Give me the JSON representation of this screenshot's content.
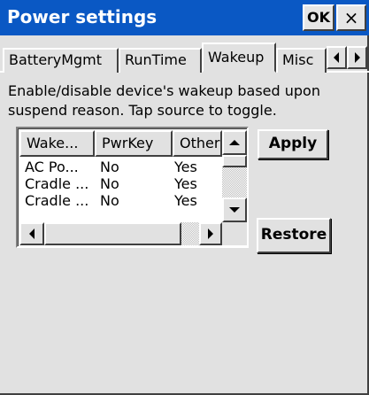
{
  "window": {
    "title": "Power settings",
    "ok_label": "OK",
    "close_label": "×"
  },
  "tabs": [
    {
      "label": "BatteryMgmt",
      "active": false
    },
    {
      "label": "RunTime",
      "active": false
    },
    {
      "label": "Wakeup",
      "active": true
    },
    {
      "label": "Misc",
      "active": false
    }
  ],
  "tab_scroll": {
    "left_icon": "triangle-left-icon",
    "right_icon": "triangle-right-icon"
  },
  "description": "Enable/disable device's wakeup based upon suspend reason. Tap source to toggle.",
  "list": {
    "columns": [
      "Wake...",
      "PwrKey",
      "Other"
    ],
    "rows": [
      [
        "AC Po...",
        "No",
        "Yes"
      ],
      [
        "Cradle ...",
        "No",
        "Yes"
      ],
      [
        "Cradle ...",
        "No",
        "Yes"
      ]
    ]
  },
  "buttons": {
    "apply": "Apply",
    "restore": "Restore"
  },
  "colors": {
    "titlebar": "#0a58c4",
    "face": "#e1e1e1"
  }
}
